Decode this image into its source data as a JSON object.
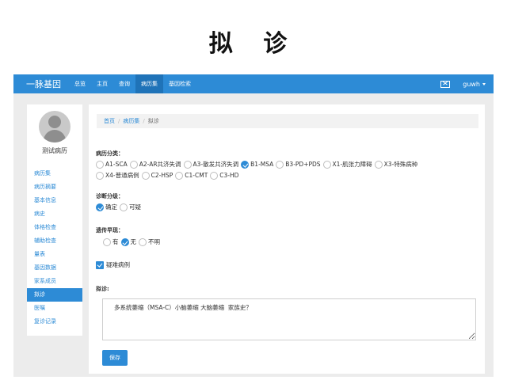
{
  "page_title": "拟 诊",
  "navbar": {
    "brand": "一脉基因",
    "items": [
      {
        "label": "总览",
        "active": false
      },
      {
        "label": "主页",
        "active": false
      },
      {
        "label": "查询",
        "active": false
      },
      {
        "label": "病历集",
        "active": true
      },
      {
        "label": "基因检索",
        "active": false
      }
    ],
    "mail_icon": "mail-icon",
    "user": "guwh"
  },
  "sidebar": {
    "avatar_icon": "user-avatar-icon",
    "patient_name": "测试病历",
    "items": [
      {
        "label": "病历集",
        "active": false
      },
      {
        "label": "病历摘要",
        "active": false
      },
      {
        "label": "基本信息",
        "active": false
      },
      {
        "label": "病史",
        "active": false
      },
      {
        "label": "体格检查",
        "active": false
      },
      {
        "label": "辅助检查",
        "active": false
      },
      {
        "label": "量表",
        "active": false
      },
      {
        "label": "基因数据",
        "active": false
      },
      {
        "label": "家系成员",
        "active": false
      },
      {
        "label": "拟诊",
        "active": true
      },
      {
        "label": "医嘱",
        "active": false
      },
      {
        "label": "复诊记录",
        "active": false
      }
    ]
  },
  "breadcrumb": {
    "home": "首页",
    "records": "病历集",
    "current": "拟诊"
  },
  "classification": {
    "label": "病历分类：",
    "options": [
      {
        "label": "A1-SCA",
        "checked": false
      },
      {
        "label": "A2-AR共济失调",
        "checked": false
      },
      {
        "label": "A3-散发共济失调",
        "checked": false
      },
      {
        "label": "B1-MSA",
        "checked": true
      },
      {
        "label": "B3-PD+PDS",
        "checked": false
      },
      {
        "label": "X1-肌张力障碍",
        "checked": false
      },
      {
        "label": "X3-特殊病种",
        "checked": false
      },
      {
        "label": "X4-普通病例",
        "checked": false
      },
      {
        "label": "C2-HSP",
        "checked": false
      },
      {
        "label": "C1-CMT",
        "checked": false
      },
      {
        "label": "C3-HD",
        "checked": false
      }
    ]
  },
  "diagnosis_level": {
    "label": "诊断分级：",
    "options": [
      {
        "label": "确定",
        "checked": true
      },
      {
        "label": "可疑",
        "checked": false
      }
    ]
  },
  "heredity": {
    "label": "遗传早现：",
    "options": [
      {
        "label": "有",
        "checked": false
      },
      {
        "label": "无",
        "checked": true
      },
      {
        "label": "不明",
        "checked": false
      }
    ]
  },
  "difficult_case": {
    "label": "疑难病例",
    "checked": true
  },
  "prelim": {
    "label": "拟诊:",
    "value": "多系统萎缩（MSA-C）小脑萎缩 大脑萎缩  家族史？"
  },
  "save_label": "保存"
}
